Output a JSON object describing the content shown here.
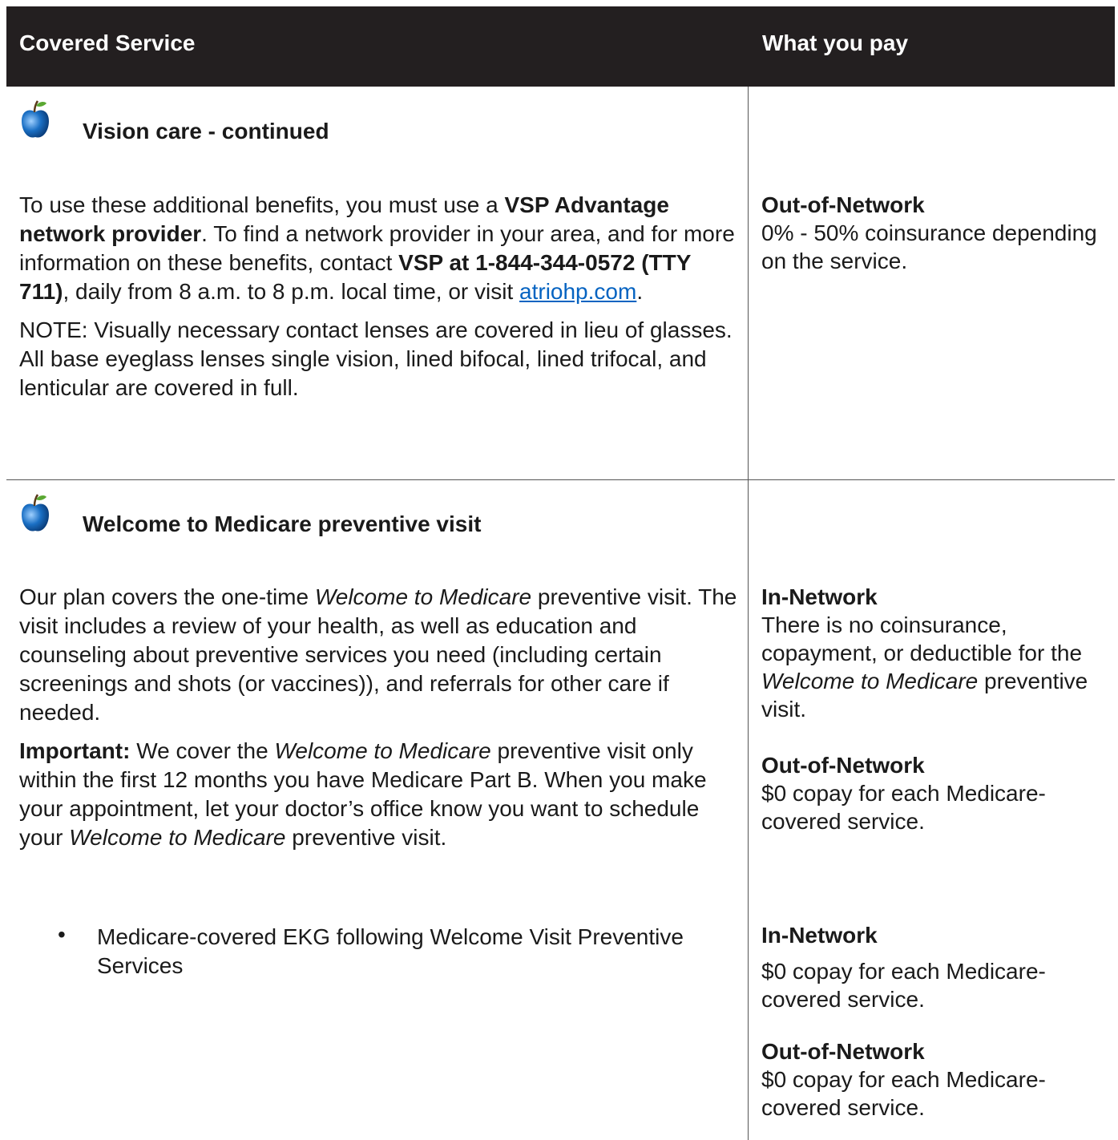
{
  "header": {
    "col1": "Covered Service",
    "col2": "What you pay"
  },
  "vision": {
    "title": "Vision care - continued",
    "p1_a": "To use these additional benefits, you must use a ",
    "p1_b": "VSP Advantage network provider",
    "p1_c": ". To find a network provider in your area, and for more information on these benefits, contact ",
    "p1_d": "VSP at 1-844-344-0572 (TTY 711)",
    "p1_e": ", daily from 8 a.m. to 8 p.m. local time, or visit ",
    "p1_link": "atriohp.com",
    "p1_f": ".",
    "note": "NOTE:  Visually necessary contact lenses are covered in lieu of glasses. All base eyeglass lenses single vision, lined bifocal, lined trifocal, and lenticular are covered in full.",
    "oon_heading": "Out-of-Network",
    "oon_text": "0% - 50% coinsurance depending on the service."
  },
  "welcome": {
    "title": "Welcome to Medicare preventive visit",
    "p1_a": "Our plan covers the one-time ",
    "p1_i": "Welcome to Medicare",
    "p1_b": " preventive visit. The visit includes a review of your health, as well as education and counseling about preventive services you need (including certain screenings and shots (or vaccines)), and referrals for other care if needed.",
    "p2_bold": "Important:",
    "p2_a": " We cover the ",
    "p2_i": "Welcome to Medicare",
    "p2_b": " preventive visit only within the first 12 months you have Medicare Part B. When you make your appointment, let your doctor’s office know you want to schedule your ",
    "p2_i2": "Welcome to Medicare",
    "p2_c": " preventive visit.",
    "bullet_symbol": "•",
    "bullet": "Medicare-covered EKG following Welcome Visit Preventive Services",
    "in_heading": "In-Network",
    "in_text_a": "There is no coinsurance, copayment, or deductible for the ",
    "in_text_i": "Welcome to Medicare",
    "in_text_b": " preventive visit.",
    "oon_heading": "Out-of-Network",
    "oon_text": "$0 copay for each Medicare-covered service.",
    "ekg_in_heading": "In-Network",
    "ekg_in_text": "$0 copay for each Medicare-covered service.",
    "ekg_oon_heading": "Out-of-Network",
    "ekg_oon_text": "$0 copay for each Medicare-covered service."
  },
  "colors": {
    "header_bg": "#231f20",
    "link": "#0563c1",
    "apple": "#1a6fc4"
  },
  "icons": {
    "row_icon": "apple-icon"
  }
}
